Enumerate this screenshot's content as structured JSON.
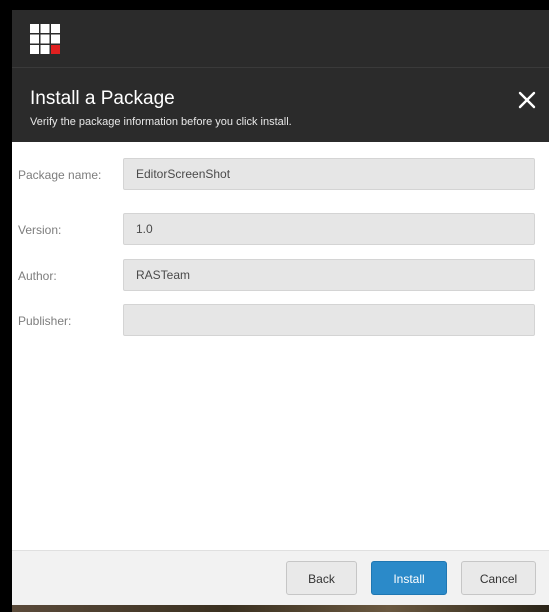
{
  "dialog": {
    "title": "Install a Package",
    "subtitle": "Verify the package information before you click install.",
    "close_icon": "close-icon"
  },
  "app": {
    "logo_icon": "grid-logo-icon",
    "accent_color": "#e02020"
  },
  "fields": [
    {
      "label": "Package name:",
      "value": "EditorScreenShot"
    },
    {
      "label": "Version:",
      "value": "1.0"
    },
    {
      "label": "Author:",
      "value": "RASTeam"
    },
    {
      "label": "Publisher:",
      "value": ""
    }
  ],
  "footer": {
    "back_label": "Back",
    "install_label": "Install",
    "cancel_label": "Cancel",
    "primary_color": "#2b8ac9"
  }
}
